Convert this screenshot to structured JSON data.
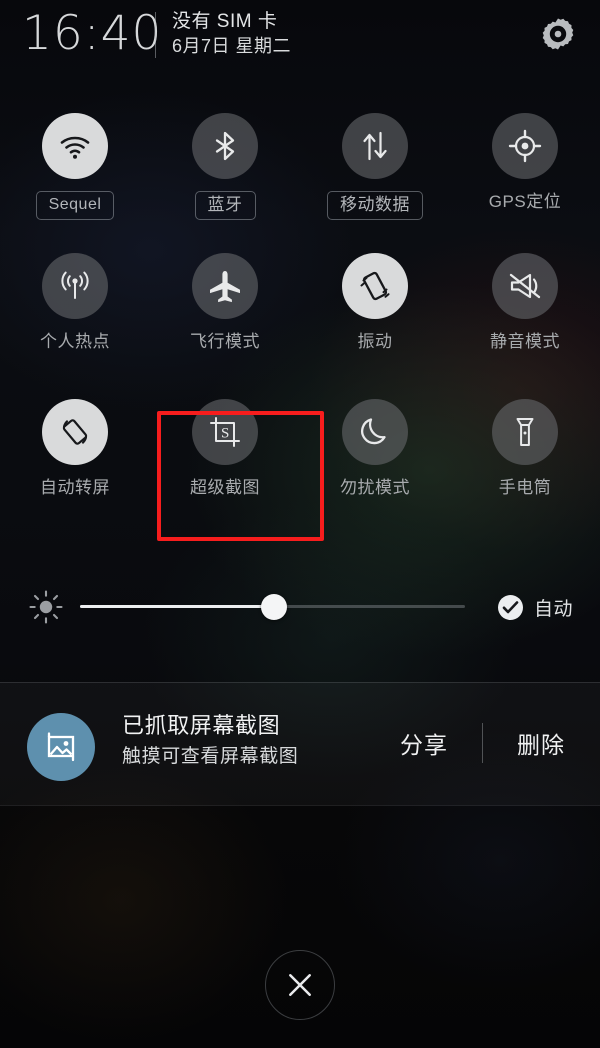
{
  "header": {
    "time": "16:40",
    "sim_status": "没有 SIM 卡",
    "date": "6月7日 星期二",
    "settings_icon": "gear-icon"
  },
  "toggles": {
    "rows": [
      [
        {
          "key": "wifi",
          "label": "Sequel",
          "icon": "wifi-icon",
          "active": true,
          "boxed": true,
          "latin": true
        },
        {
          "key": "bluetooth",
          "label": "蓝牙",
          "icon": "bluetooth-icon",
          "active": false,
          "boxed": true,
          "latin": false
        },
        {
          "key": "mobile-data",
          "label": "移动数据",
          "icon": "mobile-data-icon",
          "active": false,
          "boxed": true,
          "latin": false
        },
        {
          "key": "gps",
          "label": "GPS定位",
          "icon": "gps-icon",
          "active": false,
          "boxed": false,
          "latin": false
        }
      ],
      [
        {
          "key": "hotspot",
          "label": "个人热点",
          "icon": "hotspot-icon",
          "active": false,
          "boxed": false,
          "latin": false
        },
        {
          "key": "airplane",
          "label": "飞行模式",
          "icon": "airplane-icon",
          "active": false,
          "boxed": false,
          "latin": false
        },
        {
          "key": "vibrate",
          "label": "振动",
          "icon": "vibrate-icon",
          "active": true,
          "boxed": false,
          "latin": false
        },
        {
          "key": "silent",
          "label": "静音模式",
          "icon": "mute-icon",
          "active": false,
          "boxed": false,
          "latin": false
        }
      ],
      [
        {
          "key": "auto-rotate",
          "label": "自动转屏",
          "icon": "auto-rotate-icon",
          "active": true,
          "boxed": false,
          "latin": false
        },
        {
          "key": "super-screenshot",
          "label": "超级截图",
          "icon": "screenshot-crop-icon",
          "active": false,
          "boxed": false,
          "latin": false
        },
        {
          "key": "do-not-disturb",
          "label": "勿扰模式",
          "icon": "moon-icon",
          "active": false,
          "boxed": false,
          "latin": false
        },
        {
          "key": "flashlight",
          "label": "手电筒",
          "icon": "flashlight-icon",
          "active": false,
          "boxed": false,
          "latin": false
        }
      ]
    ],
    "highlight": {
      "target": "super-screenshot",
      "color": "#f71d1d"
    }
  },
  "brightness": {
    "icon": "brightness-sun-icon",
    "value_percent": 48,
    "auto_label": "自动",
    "auto_checked": true,
    "check_icon": "check-circle-icon"
  },
  "notification": {
    "icon": "image-screenshot-icon",
    "icon_color": "#5e90ae",
    "title": "已抓取屏幕截图",
    "subtitle": "触摸可查看屏幕截图",
    "actions": [
      {
        "key": "share",
        "label": "分享"
      },
      {
        "key": "delete",
        "label": "删除"
      }
    ]
  },
  "close": {
    "icon": "close-x-icon"
  }
}
